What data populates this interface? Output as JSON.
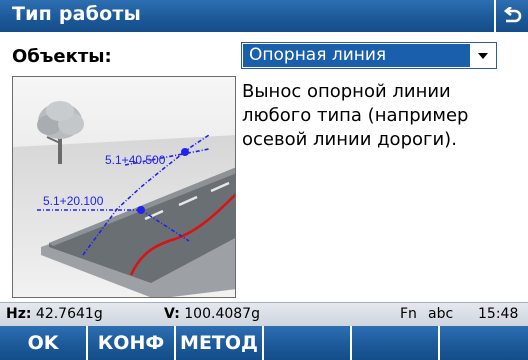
{
  "window": {
    "title": "Тип работы",
    "back_icon": "back-arrow-icon"
  },
  "form": {
    "objects_label": "Объекты:",
    "objects_select": {
      "value": "Опорная линия",
      "arrow_icon": "dropdown-arrow-icon"
    },
    "description": "Вынос опорной линии\nлюбого типа (например\nосевой линии дороги)."
  },
  "illustration": {
    "station_upper": "5.1+40.500",
    "station_lower": "5.1+20.100",
    "colors": {
      "reference_line": "#2222ee",
      "offset_line": "#dd1111",
      "road_surface": "#6a6f74"
    }
  },
  "status": {
    "hz_label": "Hz:",
    "hz_value": "42.7641g",
    "v_label": "V:",
    "v_value": "100.4087g",
    "fn": "Fn",
    "input_mode": "abc",
    "time": "15:48"
  },
  "softkeys": [
    "OK",
    "КОНФ",
    "МЕТОД",
    "",
    "",
    ""
  ],
  "colors": {
    "bar_blue": "#1c5a9a",
    "selection_blue": "#1a5fab"
  }
}
